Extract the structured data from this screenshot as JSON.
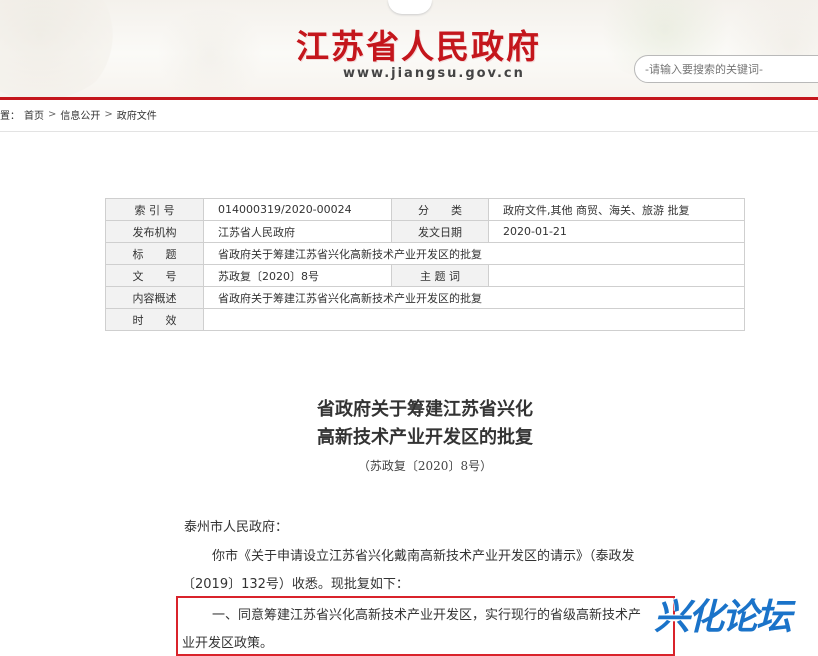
{
  "header": {
    "site_title": "江苏省人民政府",
    "site_url": "www.jiangsu.gov.cn",
    "search_placeholder": "-请输入要搜索的关键词-",
    "title_color": "#c4161c"
  },
  "breadcrumb": {
    "prefix": "置：",
    "items": [
      "首页",
      "信息公开",
      "政府文件"
    ],
    "separator": ">"
  },
  "info_table": {
    "index_label": "索 引 号",
    "index_value": "014000319/2020-00024",
    "category_label": "分　　类",
    "category_value": "政府文件,其他 商贸、海关、旅游 批复",
    "publisher_label": "发布机构",
    "publisher_value": "江苏省人民政府",
    "date_label": "发文日期",
    "date_value": "2020-01-21",
    "title_label": "标　　题",
    "title_value": "省政府关于筹建江苏省兴化高新技术产业开发区的批复",
    "docno_label": "文　　号",
    "docno_value": "苏政复〔2020〕8号",
    "keyword_label": "主 题 词",
    "keyword_value": "",
    "summary_label": "内容概述",
    "summary_value": "省政府关于筹建江苏省兴化高新技术产业开发区的批复",
    "validity_label": "时　　效",
    "validity_value": ""
  },
  "document": {
    "title_line1": "省政府关于筹建江苏省兴化",
    "title_line2": "高新技术产业开发区的批复",
    "number": "（苏政复〔2020〕8号）",
    "salutation": "泰州市人民政府：",
    "para1_line1": "你市《关于申请设立江苏省兴化戴南高新技术产业开发区的请示》（泰政发",
    "para1_line2": "〔2019〕132号）收悉。现批复如下：",
    "para2_line1": "一、同意筹建江苏省兴化高新技术产业开发区，实行现行的省级高新技术产",
    "para2_line2": "业开发区政策。"
  },
  "watermark": {
    "text": "兴化论坛",
    "color": "#1a73c9"
  }
}
